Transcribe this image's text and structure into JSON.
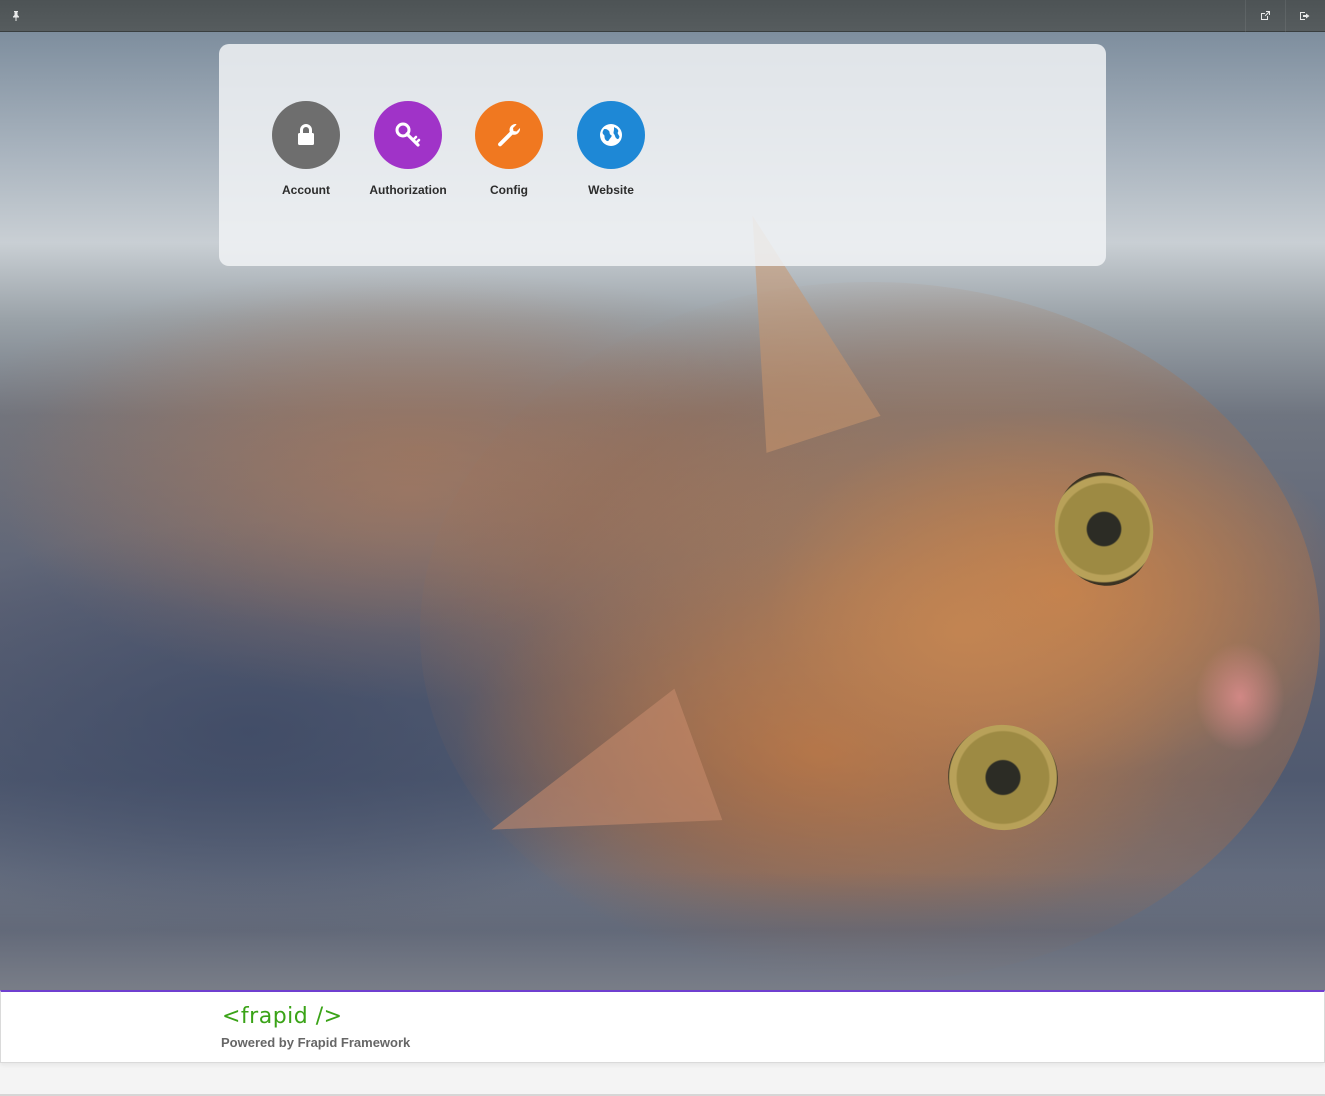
{
  "topbar": {
    "pin_icon": "pin-icon",
    "external_icon": "external-link-icon",
    "signout_icon": "sign-out-icon"
  },
  "apps": [
    {
      "label": "Account",
      "icon": "lock-icon",
      "color": "#6e6e6e"
    },
    {
      "label": "Authorization",
      "icon": "key-icon",
      "color": "#a033c8"
    },
    {
      "label": "Config",
      "icon": "wrench-icon",
      "color": "#f07820"
    },
    {
      "label": "Website",
      "icon": "globe-icon",
      "color": "#1e88d6"
    }
  ],
  "footer": {
    "logo": "<frapid />",
    "powered_by": "Powered by Frapid Framework",
    "accent_color": "#6f3fd0",
    "logo_color": "#3aa317"
  }
}
